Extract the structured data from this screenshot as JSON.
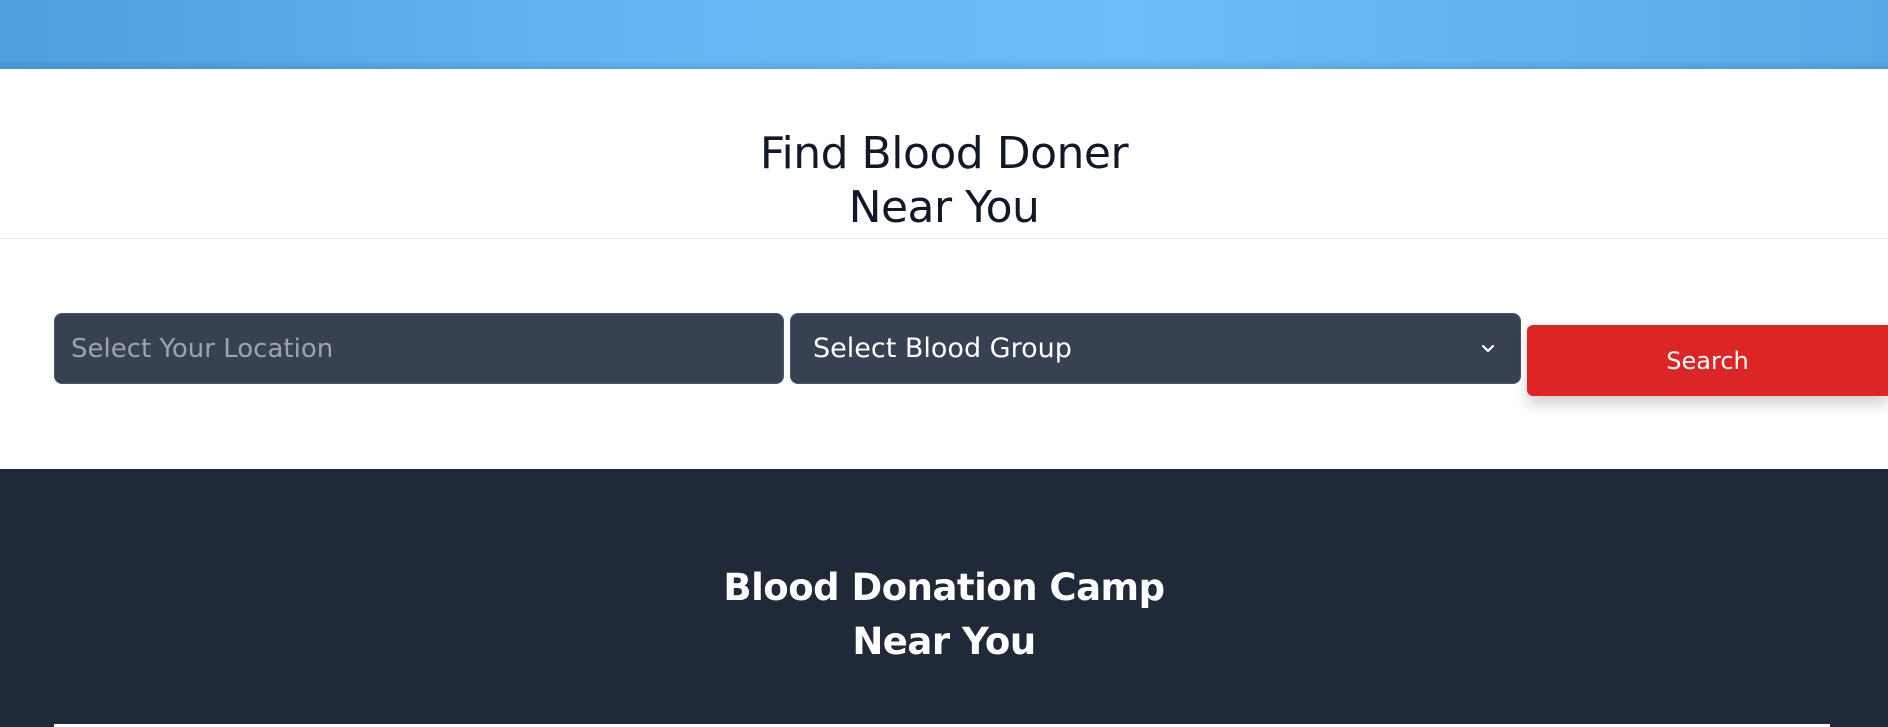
{
  "hero": {
    "colors": {
      "start": "#4e9fdc",
      "mid": "#6dbdf7"
    }
  },
  "find_section": {
    "title_line1": "Find Blood Doner",
    "title_line2": "Near You"
  },
  "search_form": {
    "location_placeholder": "Select Your Location",
    "location_value": "",
    "blood_group_selected": "Select Blood Group",
    "search_label": "Search",
    "icons": {
      "select_caret": "chevron-down-icon"
    }
  },
  "camp_section": {
    "title_line1": "Blood Donation Camp",
    "title_line2": "Near You",
    "background": "#1f2937"
  },
  "colors": {
    "accent": "#dc2626",
    "input_bg": "#374151",
    "heading": "#111827"
  }
}
